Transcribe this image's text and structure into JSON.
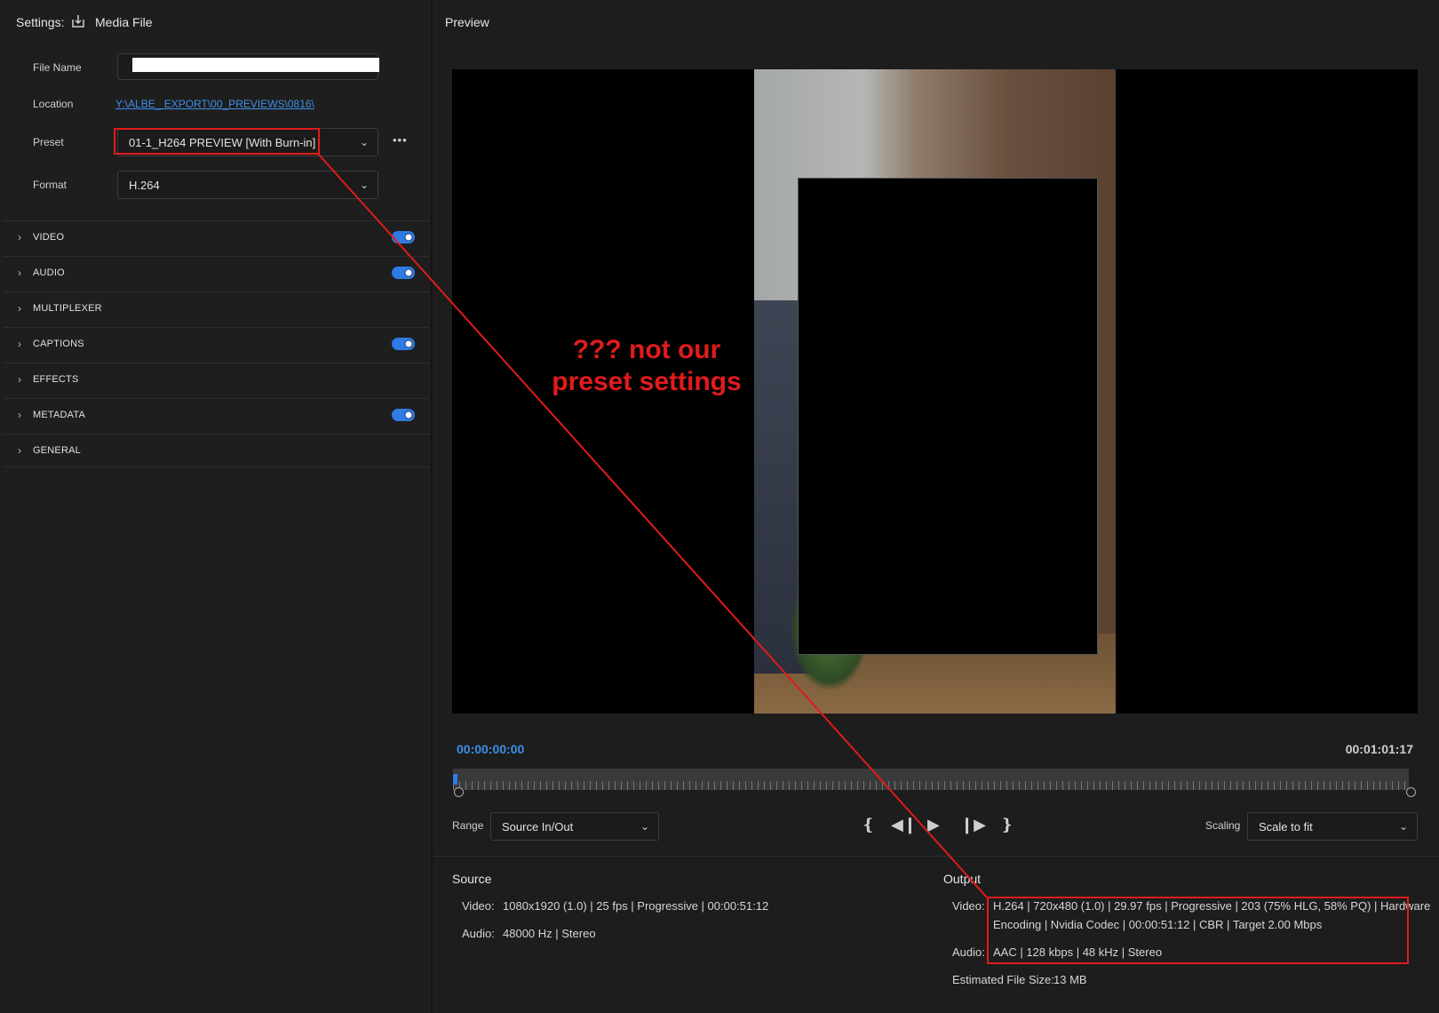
{
  "settings": {
    "title": "Settings:",
    "destination_label": "Media File",
    "file_name_label": "File Name",
    "file_name_value": "",
    "location_label": "Location",
    "location_value": "Y:\\ALBE_ EXPORT\\00_PREVIEWS\\0816\\",
    "preset_label": "Preset",
    "preset_value": "01-1_H264 PREVIEW [With Burn-in]",
    "format_label": "Format",
    "format_value": "H.264",
    "more_label": "•••",
    "sections": [
      {
        "name": "VIDEO",
        "toggle": true
      },
      {
        "name": "AUDIO",
        "toggle": true
      },
      {
        "name": "MULTIPLEXER",
        "toggle": false
      },
      {
        "name": "CAPTIONS",
        "toggle": true
      },
      {
        "name": "EFFECTS",
        "toggle": false
      },
      {
        "name": "METADATA",
        "toggle": true
      },
      {
        "name": "GENERAL",
        "toggle": false
      }
    ]
  },
  "preview": {
    "title": "Preview",
    "annotation_line1": "??? not our",
    "annotation_line2": "preset settings",
    "timecode_start": "00:00:00:00",
    "timecode_end": "00:01:01:17",
    "range_label": "Range",
    "range_value": "Source In/Out",
    "scaling_label": "Scaling",
    "scaling_value": "Scale to fit"
  },
  "source": {
    "title": "Source",
    "video_label": "Video:",
    "video_value": "1080x1920 (1.0)  |  25 fps  |  Progressive  |  00:00:51:12",
    "audio_label": "Audio:",
    "audio_value": "48000 Hz  |  Stereo"
  },
  "output": {
    "title": "Output",
    "video_label": "Video:",
    "video_line1": "H.264  |  720x480 (1.0)  |  29.97 fps  |  Progressive  |  203 (75% HLG, 58% PQ)  |  Hardware",
    "video_line2": "Encoding  |  Nvidia Codec  |  00:00:51:12   |  CBR  |  Target 2.00 Mbps",
    "audio_label": "Audio:",
    "audio_value": "AAC  |  128 kbps  |  48 kHz  |  Stereo",
    "size_label": "Estimated File Size:",
    "size_value": "13 MB"
  },
  "colors": {
    "accent": "#2f7be6",
    "annotation": "#e11b1b",
    "link": "#3d8ee8"
  }
}
